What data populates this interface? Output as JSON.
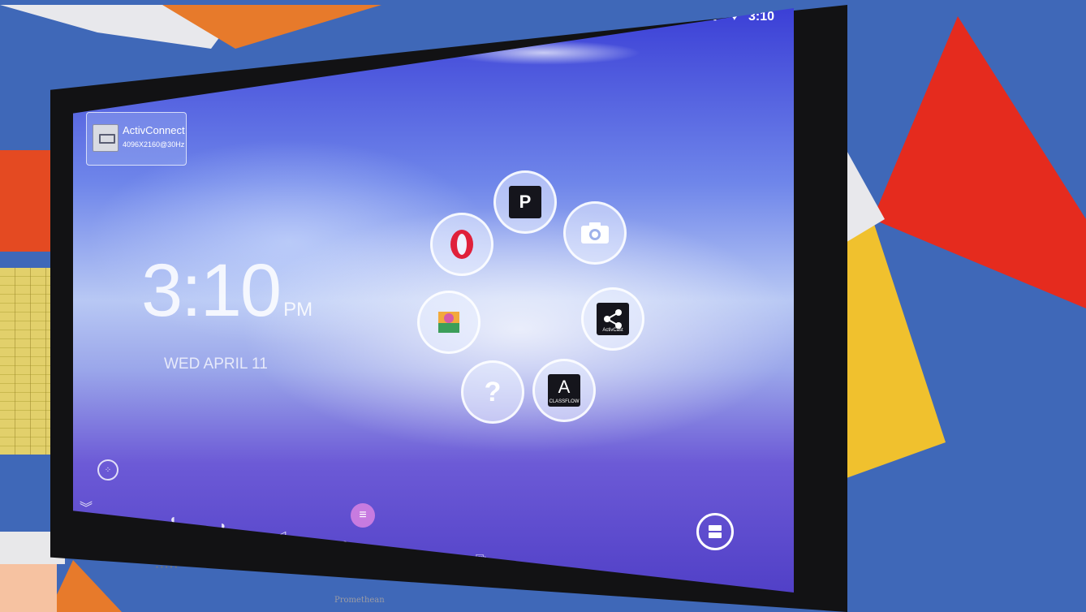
{
  "status_bar": {
    "bluetooth_icon": "bluetooth-icon",
    "wifi_icon": "wifi-icon",
    "time": "3:10"
  },
  "notification": {
    "title": "ActivConnect",
    "resolution": "4096X2160@30Hz",
    "icon": "hdmi-input-icon"
  },
  "clock": {
    "time": "3:10",
    "ampm": "PM",
    "date": "WED APRIL 11"
  },
  "app_ring": [
    {
      "name": "Opera",
      "icon": "opera-icon"
    },
    {
      "name": "Promethean Panel Store",
      "icon": "p-store-icon",
      "glyph": "P"
    },
    {
      "name": "Camera",
      "icon": "camera-icon"
    },
    {
      "name": "ActivCast",
      "icon": "activcast-icon",
      "caption": "ActivCast"
    },
    {
      "name": "ClassFlow",
      "icon": "classflow-icon",
      "glyph": "A",
      "caption": "CLASSFLOW"
    },
    {
      "name": "Help",
      "icon": "help-icon",
      "glyph": "?"
    },
    {
      "name": "Gallery",
      "icon": "gallery-icon"
    }
  ],
  "navbar": {
    "collapse_icon": "chevrons-down-icon",
    "volume_down_icon": "volume-down-icon",
    "volume_up_icon": "volume-up-icon",
    "back_icon": "back-icon",
    "home_icon": "home-icon",
    "recents_icon": "recents-icon",
    "screenshot_icon": "screenshot-icon",
    "power_icon": "power-icon",
    "menu_icon": "menu-icon",
    "apps_icon": "apps-grid-icon",
    "window_icon": "split-window-icon"
  },
  "hardware": {
    "brand": "Promethean"
  },
  "colors": {
    "menu_pill": "#c77be0",
    "opera_red": "#e0203a"
  }
}
